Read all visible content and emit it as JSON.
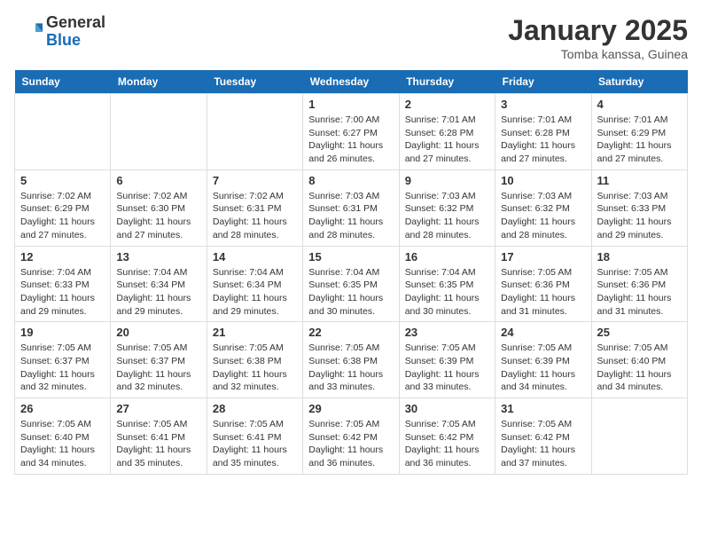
{
  "logo": {
    "general": "General",
    "blue": "Blue"
  },
  "header": {
    "month": "January 2025",
    "location": "Tomba kanssa, Guinea"
  },
  "days_of_week": [
    "Sunday",
    "Monday",
    "Tuesday",
    "Wednesday",
    "Thursday",
    "Friday",
    "Saturday"
  ],
  "weeks": [
    [
      {
        "day": "",
        "info": ""
      },
      {
        "day": "",
        "info": ""
      },
      {
        "day": "",
        "info": ""
      },
      {
        "day": "1",
        "info": "Sunrise: 7:00 AM\nSunset: 6:27 PM\nDaylight: 11 hours and 26 minutes."
      },
      {
        "day": "2",
        "info": "Sunrise: 7:01 AM\nSunset: 6:28 PM\nDaylight: 11 hours and 27 minutes."
      },
      {
        "day": "3",
        "info": "Sunrise: 7:01 AM\nSunset: 6:28 PM\nDaylight: 11 hours and 27 minutes."
      },
      {
        "day": "4",
        "info": "Sunrise: 7:01 AM\nSunset: 6:29 PM\nDaylight: 11 hours and 27 minutes."
      }
    ],
    [
      {
        "day": "5",
        "info": "Sunrise: 7:02 AM\nSunset: 6:29 PM\nDaylight: 11 hours and 27 minutes."
      },
      {
        "day": "6",
        "info": "Sunrise: 7:02 AM\nSunset: 6:30 PM\nDaylight: 11 hours and 27 minutes."
      },
      {
        "day": "7",
        "info": "Sunrise: 7:02 AM\nSunset: 6:31 PM\nDaylight: 11 hours and 28 minutes."
      },
      {
        "day": "8",
        "info": "Sunrise: 7:03 AM\nSunset: 6:31 PM\nDaylight: 11 hours and 28 minutes."
      },
      {
        "day": "9",
        "info": "Sunrise: 7:03 AM\nSunset: 6:32 PM\nDaylight: 11 hours and 28 minutes."
      },
      {
        "day": "10",
        "info": "Sunrise: 7:03 AM\nSunset: 6:32 PM\nDaylight: 11 hours and 28 minutes."
      },
      {
        "day": "11",
        "info": "Sunrise: 7:03 AM\nSunset: 6:33 PM\nDaylight: 11 hours and 29 minutes."
      }
    ],
    [
      {
        "day": "12",
        "info": "Sunrise: 7:04 AM\nSunset: 6:33 PM\nDaylight: 11 hours and 29 minutes."
      },
      {
        "day": "13",
        "info": "Sunrise: 7:04 AM\nSunset: 6:34 PM\nDaylight: 11 hours and 29 minutes."
      },
      {
        "day": "14",
        "info": "Sunrise: 7:04 AM\nSunset: 6:34 PM\nDaylight: 11 hours and 29 minutes."
      },
      {
        "day": "15",
        "info": "Sunrise: 7:04 AM\nSunset: 6:35 PM\nDaylight: 11 hours and 30 minutes."
      },
      {
        "day": "16",
        "info": "Sunrise: 7:04 AM\nSunset: 6:35 PM\nDaylight: 11 hours and 30 minutes."
      },
      {
        "day": "17",
        "info": "Sunrise: 7:05 AM\nSunset: 6:36 PM\nDaylight: 11 hours and 31 minutes."
      },
      {
        "day": "18",
        "info": "Sunrise: 7:05 AM\nSunset: 6:36 PM\nDaylight: 11 hours and 31 minutes."
      }
    ],
    [
      {
        "day": "19",
        "info": "Sunrise: 7:05 AM\nSunset: 6:37 PM\nDaylight: 11 hours and 32 minutes."
      },
      {
        "day": "20",
        "info": "Sunrise: 7:05 AM\nSunset: 6:37 PM\nDaylight: 11 hours and 32 minutes."
      },
      {
        "day": "21",
        "info": "Sunrise: 7:05 AM\nSunset: 6:38 PM\nDaylight: 11 hours and 32 minutes."
      },
      {
        "day": "22",
        "info": "Sunrise: 7:05 AM\nSunset: 6:38 PM\nDaylight: 11 hours and 33 minutes."
      },
      {
        "day": "23",
        "info": "Sunrise: 7:05 AM\nSunset: 6:39 PM\nDaylight: 11 hours and 33 minutes."
      },
      {
        "day": "24",
        "info": "Sunrise: 7:05 AM\nSunset: 6:39 PM\nDaylight: 11 hours and 34 minutes."
      },
      {
        "day": "25",
        "info": "Sunrise: 7:05 AM\nSunset: 6:40 PM\nDaylight: 11 hours and 34 minutes."
      }
    ],
    [
      {
        "day": "26",
        "info": "Sunrise: 7:05 AM\nSunset: 6:40 PM\nDaylight: 11 hours and 34 minutes."
      },
      {
        "day": "27",
        "info": "Sunrise: 7:05 AM\nSunset: 6:41 PM\nDaylight: 11 hours and 35 minutes."
      },
      {
        "day": "28",
        "info": "Sunrise: 7:05 AM\nSunset: 6:41 PM\nDaylight: 11 hours and 35 minutes."
      },
      {
        "day": "29",
        "info": "Sunrise: 7:05 AM\nSunset: 6:42 PM\nDaylight: 11 hours and 36 minutes."
      },
      {
        "day": "30",
        "info": "Sunrise: 7:05 AM\nSunset: 6:42 PM\nDaylight: 11 hours and 36 minutes."
      },
      {
        "day": "31",
        "info": "Sunrise: 7:05 AM\nSunset: 6:42 PM\nDaylight: 11 hours and 37 minutes."
      },
      {
        "day": "",
        "info": ""
      }
    ]
  ]
}
